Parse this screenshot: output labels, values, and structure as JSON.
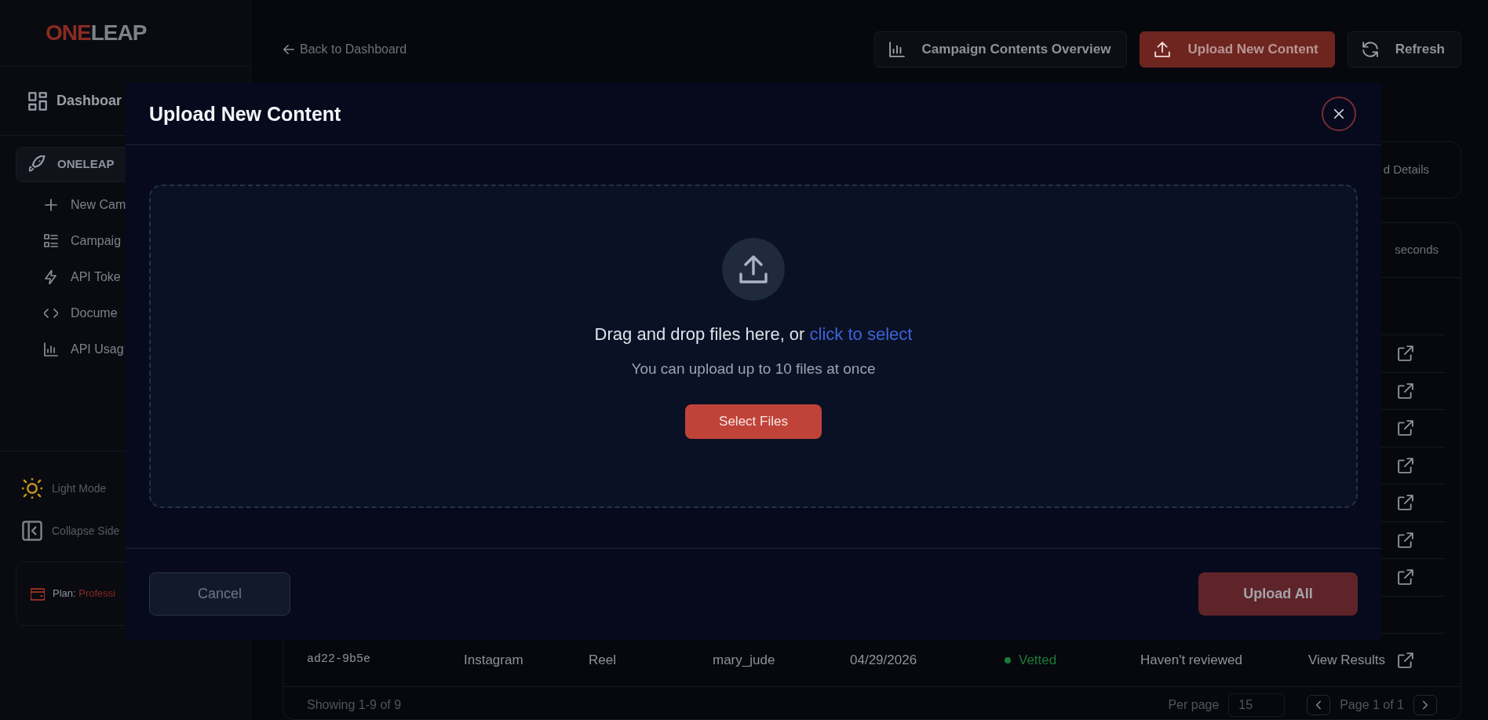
{
  "sidebar": {
    "logo": {
      "accent": "ONE",
      "rest": "LEAP"
    },
    "dashboard": "Dashboar",
    "section": {
      "label": "ONELEAP",
      "selected": true
    },
    "items": [
      {
        "label": "New Cam",
        "kind": "plus"
      },
      {
        "label": "Campaig",
        "kind": "list"
      },
      {
        "label": "API Toke",
        "kind": "bolt"
      },
      {
        "label": "Docume",
        "kind": "code"
      },
      {
        "label": "API Usag",
        "kind": "chart"
      }
    ],
    "bottom": [
      {
        "label": "Light Mode",
        "kind": "sun"
      },
      {
        "label": "Collapse Side",
        "kind": "collapse"
      }
    ],
    "plan": {
      "label": "Plan:",
      "value": "Professi"
    }
  },
  "header": {
    "back": "Back to Dashboard",
    "buttons": [
      {
        "label": "Campaign Contents Overview",
        "kind": "chart",
        "primary": false
      },
      {
        "label": "Upload New Content",
        "kind": "upload",
        "primary": true
      },
      {
        "label": "Refresh",
        "kind": "refresh",
        "primary": false
      }
    ]
  },
  "details_card": {
    "text": "d Details"
  },
  "table_card": {
    "note": "seconds",
    "rows": [
      {
        "kind": "covered"
      },
      {
        "kind": "covered"
      },
      {
        "kind": "covered"
      },
      {
        "kind": "covered"
      },
      {
        "kind": "covered"
      },
      {
        "kind": "covered"
      },
      {
        "kind": "covered"
      },
      {
        "kind": "blank"
      },
      {
        "kind": "full",
        "id": "ad22-9b5e",
        "platform": "Instagram",
        "type": "Reel",
        "creator": "mary_jude",
        "date": "04/29/2026",
        "status": {
          "label": "Vetted",
          "color": "#1c7a36"
        },
        "review": "Haven't reviewed",
        "action": "View Results"
      }
    ]
  },
  "footer": {
    "showing": "Showing 1-9 of 9",
    "per_page_label": "Per page",
    "per_page": "15",
    "page": "Page 1 of 1"
  },
  "modal": {
    "title": "Upload New Content",
    "drop_text": "Drag and drop files here, or ",
    "drop_link": "click to select",
    "hint": "You can upload up to 10 files at once",
    "select_button": "Select Files",
    "cancel": {
      "label": "Cancel",
      "disabled": true
    },
    "upload_all": {
      "label": "Upload All",
      "disabled": true
    }
  }
}
